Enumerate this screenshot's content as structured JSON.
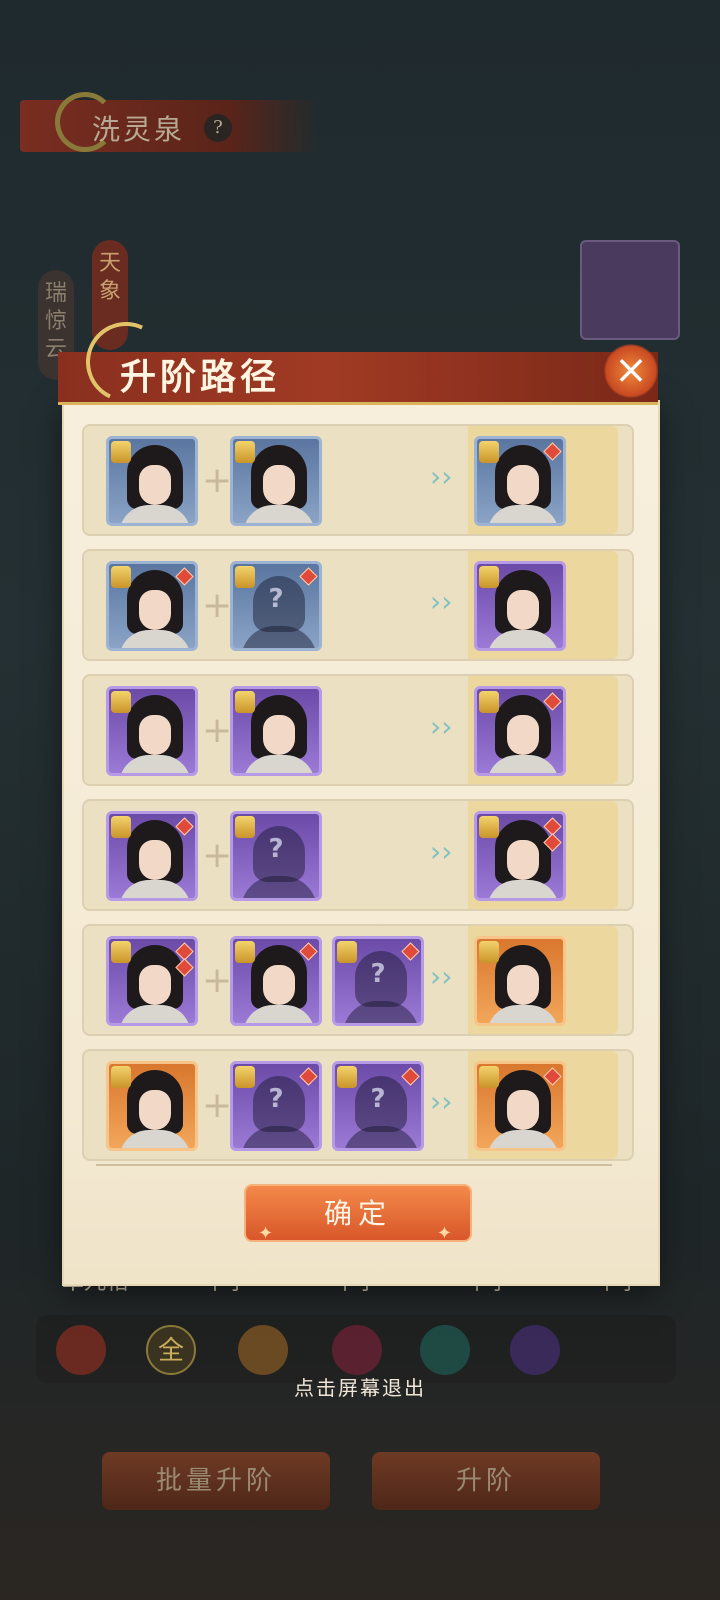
{
  "background": {
    "title": "洗灵泉",
    "help": "?",
    "vertical_labels": [
      "瑞惊云",
      "天象"
    ],
    "names": [
      "卓九相",
      "十字",
      "十字",
      "十字",
      "十字"
    ],
    "skill_center": "全",
    "buttons": {
      "batch": "批量升阶",
      "upgrade": "升阶"
    },
    "exit_hint": "点击屏幕退出"
  },
  "dialog": {
    "title": "升阶路径",
    "close_symbol": "×",
    "confirm_label": "确定",
    "plus": "+",
    "arrow": "›",
    "question": "?",
    "rows": [
      {
        "inputs": [
          {
            "color": "blue",
            "gems": 0,
            "unknown": false
          },
          {
            "color": "blue",
            "gems": 0,
            "unknown": false
          }
        ],
        "result": {
          "color": "blue",
          "gems": 1
        }
      },
      {
        "inputs": [
          {
            "color": "blue",
            "gems": 1,
            "unknown": false
          },
          {
            "color": "blue",
            "gems": 1,
            "unknown": true
          }
        ],
        "result": {
          "color": "purple",
          "gems": 0
        }
      },
      {
        "inputs": [
          {
            "color": "purple",
            "gems": 0,
            "unknown": false
          },
          {
            "color": "purple",
            "gems": 0,
            "unknown": false
          }
        ],
        "result": {
          "color": "purple",
          "gems": 1
        }
      },
      {
        "inputs": [
          {
            "color": "purple",
            "gems": 1,
            "unknown": false
          },
          {
            "color": "purple",
            "gems": 0,
            "unknown": true
          }
        ],
        "result": {
          "color": "purple",
          "gems": 2
        }
      },
      {
        "inputs": [
          {
            "color": "purple",
            "gems": 2,
            "unknown": false
          },
          {
            "color": "purple",
            "gems": 1,
            "unknown": false
          },
          {
            "color": "purple",
            "gems": 1,
            "unknown": true
          }
        ],
        "result": {
          "color": "orange",
          "gems": 0
        }
      },
      {
        "inputs": [
          {
            "color": "orange",
            "gems": 0,
            "unknown": false
          },
          {
            "color": "purple",
            "gems": 1,
            "unknown": true
          },
          {
            "color": "purple",
            "gems": 1,
            "unknown": true
          }
        ],
        "result": {
          "color": "orange",
          "gems": 1
        }
      }
    ]
  }
}
